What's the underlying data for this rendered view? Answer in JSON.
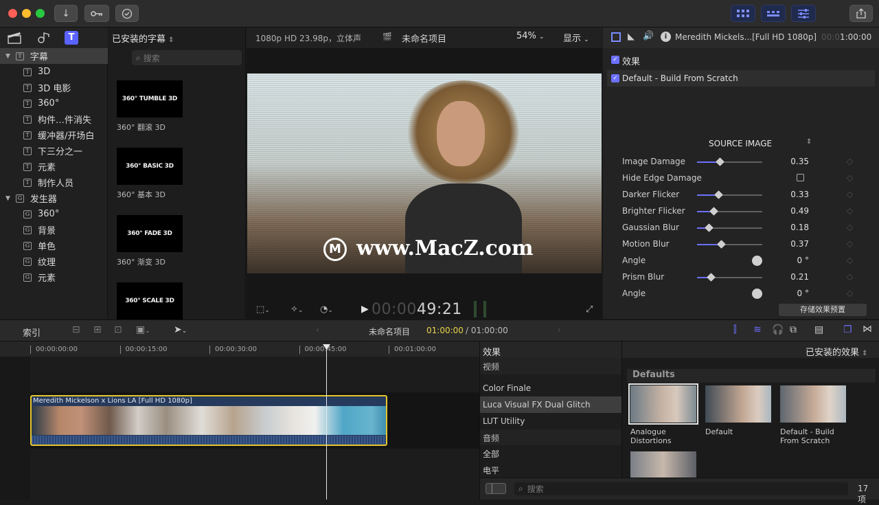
{
  "toolbar": {
    "import_icon": "download-arrow-icon",
    "key_icon": "keywords-key-icon",
    "check_icon": "background-tasks-check-icon",
    "share_icon": "share-icon"
  },
  "library": {
    "browser_title": "已安装的字幕",
    "search_placeholder": "搜索",
    "tree": [
      {
        "label": "字幕",
        "level": 0,
        "selected": true,
        "icon": "T"
      },
      {
        "label": "3D",
        "level": 1,
        "icon": "T"
      },
      {
        "label": "3D 电影",
        "level": 1,
        "icon": "T"
      },
      {
        "label": "360°",
        "level": 1,
        "icon": "T"
      },
      {
        "label": "构件…件消失",
        "level": 1,
        "icon": "T"
      },
      {
        "label": "缓冲器/开场白",
        "level": 1,
        "icon": "T"
      },
      {
        "label": "下三分之一",
        "level": 1,
        "icon": "T"
      },
      {
        "label": "元素",
        "level": 1,
        "icon": "T"
      },
      {
        "label": "制作人员",
        "level": 1,
        "icon": "T"
      },
      {
        "label": "发生器",
        "level": 0,
        "icon": "G"
      },
      {
        "label": "360°",
        "level": 1,
        "icon": "G"
      },
      {
        "label": "背景",
        "level": 1,
        "icon": "G"
      },
      {
        "label": "单色",
        "level": 1,
        "icon": "G"
      },
      {
        "label": "纹理",
        "level": 1,
        "icon": "G"
      },
      {
        "label": "元素",
        "level": 1,
        "icon": "G"
      }
    ],
    "thumbs": [
      {
        "text": "360° TUMBLE 3D",
        "caption": "360° 翻滚 3D"
      },
      {
        "text": "360° BASIC 3D",
        "caption": "360° 基本 3D"
      },
      {
        "text": "360° FADE 3D",
        "caption": "360° 渐变 3D"
      },
      {
        "text": "360° SCALE 3D",
        "caption": ""
      }
    ]
  },
  "viewer": {
    "format": "1080p HD 23.98p，立体声",
    "project": "未命名项目",
    "zoom": "54%",
    "display": "显示",
    "watermark": "www.MacZ.com",
    "timecode_dim": "00:00",
    "timecode": "49:21"
  },
  "inspector": {
    "clip_name": "Meredith Mickels...[Full HD 1080p]",
    "timecode_dim": "00:0",
    "timecode": "1:00:00",
    "effects_label": "效果",
    "effect_name": "Default - Build From Scratch",
    "section": "SOURCE IMAGE",
    "params": [
      {
        "label": "Image Damage",
        "type": "slider",
        "value": "0.35",
        "level": 0.35
      },
      {
        "label": "Hide Edge Damage",
        "type": "checkbox",
        "value": ""
      },
      {
        "label": "Darker Flicker",
        "type": "slider",
        "value": "0.33",
        "level": 0.33
      },
      {
        "label": "Brighter Flicker",
        "type": "slider",
        "value": "0.49",
        "level": 0.25
      },
      {
        "label": "Gaussian Blur",
        "type": "slider",
        "value": "0.18",
        "level": 0.18
      },
      {
        "label": "Motion Blur",
        "type": "slider",
        "value": "0.37",
        "level": 0.37
      },
      {
        "label": "Angle",
        "type": "dial",
        "value": "0 °"
      },
      {
        "label": "Prism Blur",
        "type": "slider",
        "value": "0.21",
        "level": 0.21
      },
      {
        "label": "Angle",
        "type": "dial",
        "value": "0 °"
      }
    ],
    "save_button": "存储效果预置"
  },
  "timeline": {
    "index_label": "索引",
    "project": "未命名项目",
    "position": "01:00:00",
    "duration": "/ 01:00:00",
    "ruler": [
      "00:00:00:00",
      "00:00:15:00",
      "00:00:30:00",
      "00:00:45:00",
      "00:01:00:00"
    ],
    "clip_title": "Meredith Mickelson x Lions LA [Full HD 1080p]"
  },
  "effects_browser": {
    "header": "效果",
    "installed": "已安装的效果",
    "categories": [
      {
        "label": "视频",
        "selected": false,
        "header": true
      },
      {
        "label": "Color Finale",
        "selected": false
      },
      {
        "label": "Luca Visual FX Dual Glitch",
        "selected": true
      },
      {
        "label": "LUT Utility",
        "selected": false
      },
      {
        "label": "音频",
        "selected": false,
        "header": true
      },
      {
        "label": "全部",
        "selected": false
      },
      {
        "label": "电平",
        "selected": false
      }
    ],
    "group_title": "Defaults",
    "items": [
      {
        "label": "Analogue Distortions",
        "selected": true
      },
      {
        "label": "Default",
        "selected": false
      },
      {
        "label": "Default - Build From Scratch",
        "selected": false
      }
    ],
    "search_placeholder": "搜索",
    "count": "17 项"
  },
  "colors": {
    "accent": "#6c71ff",
    "clip_border": "#e6c62e",
    "timecode_yellow": "#e8d44a"
  }
}
